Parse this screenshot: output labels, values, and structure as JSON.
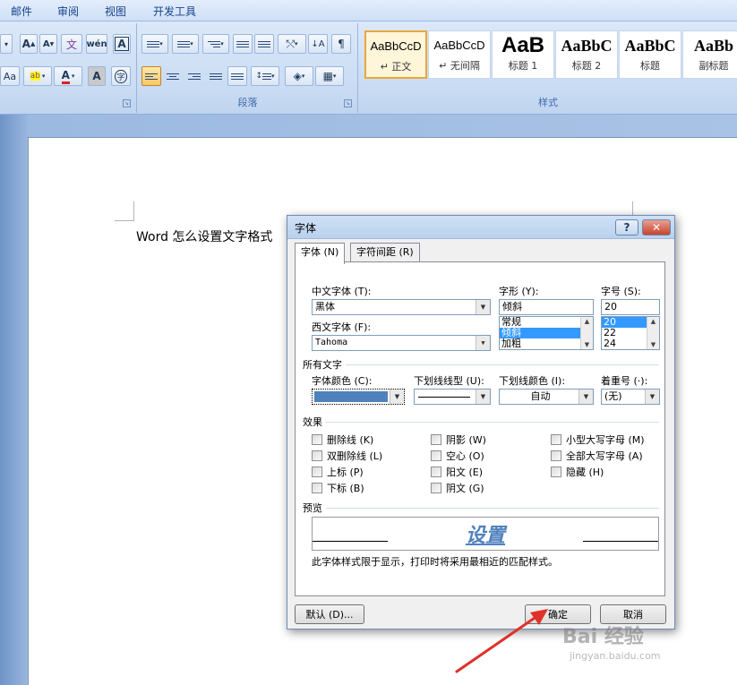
{
  "menu": [
    "邮件",
    "审阅",
    "视图",
    "开发工具"
  ],
  "ribbon": {
    "groups": {
      "paragraph": "段落",
      "styles": "样式"
    },
    "font_buttons": {
      "grow": "A",
      "shrink": "A",
      "phonetic": "文",
      "wen": "wén",
      "charborder": "A",
      "aa": "Aa",
      "highlight": "ab",
      "fontcolor": "A",
      "shading": "A",
      "enclose": "字"
    },
    "style_tiles": [
      {
        "sample": "AaBbCcD",
        "name": "↵ 正文"
      },
      {
        "sample": "AaBbCcD",
        "name": "↵ 无间隔"
      },
      {
        "sample": "AaB",
        "name": "标题 1"
      },
      {
        "sample": "AaBbC",
        "name": "标题 2"
      },
      {
        "sample": "AaBbC",
        "name": "标题"
      },
      {
        "sample": "AaBb",
        "name": "副标题"
      }
    ]
  },
  "document": {
    "text": "Word 怎么设置文字格式"
  },
  "dialog": {
    "title": "字体",
    "help": "?",
    "close": "✕",
    "tabs": [
      "字体 (N)",
      "字符间距 (R)"
    ],
    "labels": {
      "chinese_font": "中文字体 (T):",
      "western_font": "西文字体 (F):",
      "style": "字形 (Y):",
      "size": "字号 (S):",
      "all_text": "所有文字",
      "font_color": "字体颜色 (C):",
      "underline_type": "下划线线型 (U):",
      "underline_color": "下划线颜色 (I):",
      "emphasis": "着重号 (·):",
      "effects": "效果",
      "preview": "预览"
    },
    "values": {
      "chinese_font": "黑体",
      "western_font": "Tahoma",
      "style": "倾斜",
      "size": "20",
      "underline_color": "自动",
      "emphasis": "(无)"
    },
    "style_list": [
      "常规",
      "倾斜",
      "加粗"
    ],
    "style_selected": "倾斜",
    "size_list": [
      "20",
      "22",
      "24"
    ],
    "size_selected": "20",
    "font_color_hex": "#4f81bd",
    "effects_col1": [
      "删除线 (K)",
      "双删除线 (L)",
      "上标 (P)",
      "下标 (B)"
    ],
    "effects_col2": [
      "阴影 (W)",
      "空心 (O)",
      "阳文 (E)",
      "阴文 (G)"
    ],
    "effects_col3": [
      "小型大写字母 (M)",
      "全部大写字母 (A)",
      "隐藏 (H)"
    ],
    "preview_text": "设置",
    "note": "此字体样式限于显示，打印时将采用最相近的匹配样式。",
    "buttons": {
      "default": "默认 (D)...",
      "ok": "确定",
      "cancel": "取消"
    }
  },
  "watermark": {
    "brand": "Bai 经验",
    "url": "jingyan.baidu.com"
  }
}
